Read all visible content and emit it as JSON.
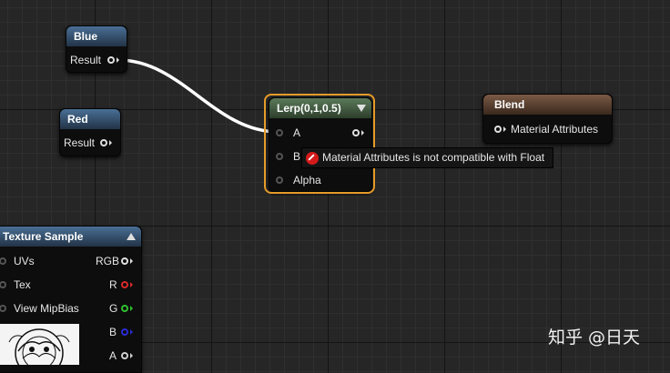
{
  "nodes": {
    "blue": {
      "title": "Blue",
      "output": "Result"
    },
    "red": {
      "title": "Red",
      "output": "Result"
    },
    "lerp": {
      "title": "Lerp(0,1,0.5)",
      "inputs": [
        "A",
        "B",
        "Alpha"
      ]
    },
    "blend": {
      "title": "Blend",
      "input": "Material Attributes"
    },
    "texture_sample": {
      "title": "Texture Sample",
      "inputs": [
        "UVs",
        "Tex",
        "View MipBias"
      ],
      "outputs": [
        "RGB",
        "R",
        "G",
        "B",
        "A"
      ]
    }
  },
  "tooltip": {
    "text": "Material Attributes is not compatible with Float"
  },
  "watermark": "知乎 @日天",
  "colors": {
    "selection_outline": "#e59b28",
    "pin_r": "#d9282b",
    "pin_g": "#2fc12f",
    "pin_b": "#2b2bd6",
    "pin_a": "#cfcfcf",
    "error_icon": "#d41a1a"
  }
}
